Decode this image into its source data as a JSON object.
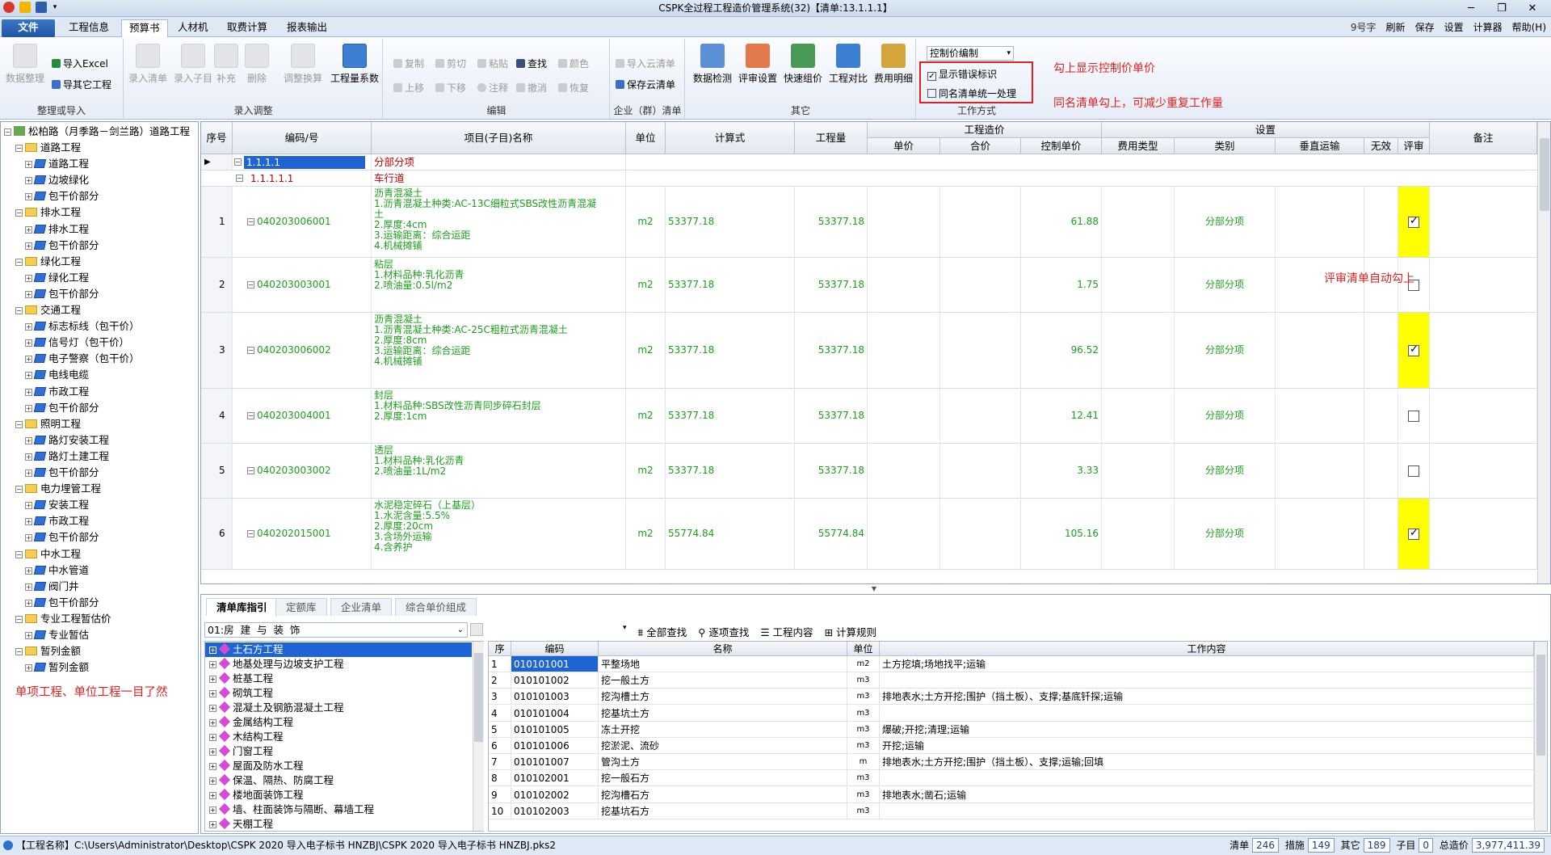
{
  "window": {
    "title": "CSPK全过程工程造价管理系统(32)【清单:13.1.1.1】"
  },
  "menu": {
    "file": "文件",
    "tabs": [
      "工程信息",
      "预算书",
      "人材机",
      "取费计算",
      "报表输出"
    ],
    "active_tab": "预算书",
    "right_items": [
      "9号字",
      "刷新",
      "保存",
      "设置",
      "计算器",
      "帮助(H)"
    ]
  },
  "ribbon": {
    "g1": {
      "label": "整理或导入",
      "data_tidy": "数据整理",
      "import_excel": "导入Excel",
      "import_other": "导其它工程"
    },
    "g2": {
      "label": "录入调整",
      "btns": [
        "录入清单",
        "录入子目",
        "补充",
        "删除",
        "调整换算",
        "工程量系数"
      ]
    },
    "g3": {
      "label": "编辑",
      "row1": [
        "复制",
        "剪切",
        "粘贴",
        "查找",
        "颜色"
      ],
      "row2": [
        "上移",
        "下移",
        "注释",
        "撤消",
        "恢复"
      ]
    },
    "g4": {
      "label": "企业（群）清单",
      "import_cloud": "导入云清单",
      "save_cloud": "保存云清单"
    },
    "g5": {
      "label": "其它",
      "btns": [
        "数据检测",
        "评审设置",
        "快速组价",
        "工程对比",
        "费用明细"
      ]
    },
    "g6": {
      "label": "工作方式",
      "select": "控制价编制",
      "chk_error": "显示错误标识",
      "chk_same": "同名清单统一处理"
    }
  },
  "annotations": {
    "a1": "勾上显示控制价单价",
    "a2": "同名清单勾上，可减少重复工作量",
    "a3": "评审清单自动勾上",
    "a4": "单项工程、单位工程一目了然"
  },
  "tree": {
    "root": "松柏路（月季路－剑兰路）道路工程",
    "nodes": [
      {
        "t": "道路工程",
        "lv": 1
      },
      {
        "t": "道路工程",
        "lv": 2
      },
      {
        "t": "边坡绿化",
        "lv": 2
      },
      {
        "t": "包干价部分",
        "lv": 2
      },
      {
        "t": "排水工程",
        "lv": 1
      },
      {
        "t": "排水工程",
        "lv": 2
      },
      {
        "t": "包干价部分",
        "lv": 2
      },
      {
        "t": "绿化工程",
        "lv": 1
      },
      {
        "t": "绿化工程",
        "lv": 2
      },
      {
        "t": "包干价部分",
        "lv": 2
      },
      {
        "t": "交通工程",
        "lv": 1
      },
      {
        "t": "标志标线（包干价）",
        "lv": 2
      },
      {
        "t": "信号灯（包干价）",
        "lv": 2
      },
      {
        "t": "电子警察（包干价）",
        "lv": 2
      },
      {
        "t": "电线电缆",
        "lv": 2
      },
      {
        "t": "市政工程",
        "lv": 2
      },
      {
        "t": "包干价部分",
        "lv": 2
      },
      {
        "t": "照明工程",
        "lv": 1
      },
      {
        "t": "路灯安装工程",
        "lv": 2
      },
      {
        "t": "路灯土建工程",
        "lv": 2
      },
      {
        "t": "包干价部分",
        "lv": 2
      },
      {
        "t": "电力埋管工程",
        "lv": 1
      },
      {
        "t": "安装工程",
        "lv": 2
      },
      {
        "t": "市政工程",
        "lv": 2
      },
      {
        "t": "包干价部分",
        "lv": 2
      },
      {
        "t": "中水工程",
        "lv": 1
      },
      {
        "t": "中水管道",
        "lv": 2
      },
      {
        "t": "阀门井",
        "lv": 2
      },
      {
        "t": "包干价部分",
        "lv": 2
      },
      {
        "t": "专业工程暂估价",
        "lv": 1
      },
      {
        "t": "专业暂估",
        "lv": 2
      },
      {
        "t": "暂列金额",
        "lv": 1
      },
      {
        "t": "暂列金额",
        "lv": 2
      }
    ]
  },
  "grid": {
    "headers": {
      "seq": "序号",
      "code": "编码/号",
      "name": "项目(子目)名称",
      "unit": "单位",
      "formula": "计算式",
      "qty": "工程量",
      "cost_group": "工程造价",
      "unit_price": "单价",
      "total": "合价",
      "ctrl_price": "控制单价",
      "settings": "设置",
      "fee_type": "费用类型",
      "category": "类别",
      "vertical": "垂直运输",
      "invalid": "无效",
      "review": "评审",
      "remark": "备注"
    },
    "section": {
      "code": "1.1.1.1",
      "name": "分部分项"
    },
    "subsection": {
      "code": "1.1.1.1.1",
      "name": "车行道"
    },
    "rows": [
      {
        "seq": "1",
        "code": "040203006001",
        "name": [
          "沥青混凝土",
          "1.沥青混凝土种类:AC-13C细粒式SBS改性沥青混凝",
          "土",
          "2.厚度:4cm",
          "3.运输距离：综合运距",
          "4.机械摊铺"
        ],
        "unit": "m2",
        "formula": "53377.18",
        "qty": "53377.18",
        "ctrl": "61.88",
        "category": "分部分项",
        "review": true
      },
      {
        "seq": "2",
        "code": "040203003001",
        "name": [
          "粘层",
          "1.材料品种:乳化沥青",
          "2.喷油量:0.5l/m2"
        ],
        "unit": "m2",
        "formula": "53377.18",
        "qty": "53377.18",
        "ctrl": "1.75",
        "category": "分部分项",
        "review": false
      },
      {
        "seq": "3",
        "code": "040203006002",
        "name": [
          "沥青混凝土",
          "1.沥青混凝土种类:AC-25C粗粒式沥青混凝土",
          "2.厚度:8cm",
          "3.运输距离：综合运距",
          "4.机械摊铺"
        ],
        "unit": "m2",
        "formula": "53377.18",
        "qty": "53377.18",
        "ctrl": "96.52",
        "category": "分部分项",
        "review": true
      },
      {
        "seq": "4",
        "code": "040203004001",
        "name": [
          "封层",
          "1.材料品种:SBS改性沥青同步碎石封层",
          "2.厚度:1cm"
        ],
        "unit": "m2",
        "formula": "53377.18",
        "qty": "53377.18",
        "ctrl": "12.41",
        "category": "分部分项",
        "review": false
      },
      {
        "seq": "5",
        "code": "040203003002",
        "name": [
          "透层",
          "1.材料品种:乳化沥青",
          "2.喷油量:1L/m2"
        ],
        "unit": "m2",
        "formula": "53377.18",
        "qty": "53377.18",
        "ctrl": "3.33",
        "category": "分部分项",
        "review": false
      },
      {
        "seq": "6",
        "code": "040202015001",
        "name": [
          "水泥稳定碎石（上基层）",
          "1.水泥含量:5.5%",
          "2.厚度:20cm",
          "3.含场外运输",
          "4.含养护"
        ],
        "unit": "m2",
        "formula": "55774.84",
        "qty": "55774.84",
        "ctrl": "105.16",
        "category": "分部分项",
        "review": true
      }
    ]
  },
  "bottom": {
    "tabs": [
      "清单库指引",
      "定额库",
      "企业清单",
      "综合单价组成"
    ],
    "lib_select": "01:房  建  与  装  饰",
    "tools": [
      "全部查找",
      "逐项查找",
      "工程内容",
      "计算规则"
    ],
    "lib_items": [
      "土石方工程",
      "地基处理与边坡支护工程",
      "桩基工程",
      "砌筑工程",
      "混凝土及钢筋混凝土工程",
      "金属结构工程",
      "木结构工程",
      "门窗工程",
      "屋面及防水工程",
      "保温、隔热、防腐工程",
      "楼地面装饰工程",
      "墙、柱面装饰与隔断、幕墙工程",
      "天棚工程"
    ],
    "qheaders": [
      "序",
      "编码",
      "名称",
      "单位",
      "工作内容"
    ],
    "qrows": [
      [
        "1",
        "010101001",
        "平整场地",
        "m2",
        "土方挖填;场地找平;运输"
      ],
      [
        "2",
        "010101002",
        "挖一般土方",
        "m3",
        ""
      ],
      [
        "3",
        "010101003",
        "挖沟槽土方",
        "m3",
        "排地表水;土方开挖;围护（挡土板）、支撑;基底钎探;运输"
      ],
      [
        "4",
        "010101004",
        "挖基坑土方",
        "m3",
        ""
      ],
      [
        "5",
        "010101005",
        "冻土开挖",
        "m3",
        "爆破;开挖;清理;运输"
      ],
      [
        "6",
        "010101006",
        "挖淤泥、流砂",
        "m3",
        "开挖;运输"
      ],
      [
        "7",
        "010101007",
        "管沟土方",
        "m",
        "排地表水;土方开挖;围护（挡土板）、支撑;运输;回填"
      ],
      [
        "8",
        "010102001",
        "挖一般石方",
        "m3",
        ""
      ],
      [
        "9",
        "010102002",
        "挖沟槽石方",
        "m3",
        "排地表水;凿石;运输"
      ],
      [
        "10",
        "010102003",
        "挖基坑石方",
        "m3",
        ""
      ]
    ]
  },
  "status": {
    "path": "【工程名称】C:\\Users\\Administrator\\Desktop\\CSPK 2020 导入电子标书 HNZBJ\\CSPK 2020 导入电子标书 HNZBJ.pks2",
    "qd_label": "清单",
    "qd": "246",
    "cs_label": "措施",
    "cs": "149",
    "qt_label": "其它",
    "qt": "189",
    "zm_label": "子目",
    "zm": "0",
    "total_label": "总造价",
    "total": "3,977,411.39"
  },
  "colors": {
    "green_text": "#1c9e1c",
    "red_text": "#c00000",
    "yellow": "#ffff00",
    "annot_red": "#e31f1f",
    "selection": "#1e64d2"
  }
}
